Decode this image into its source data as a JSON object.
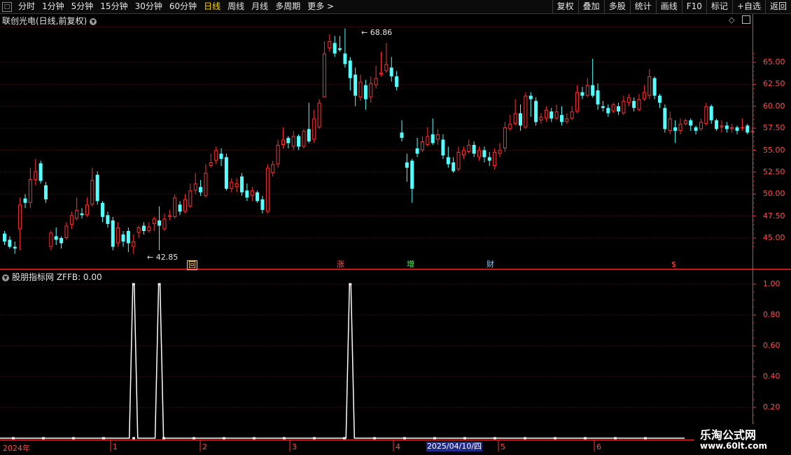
{
  "toolbar": {
    "period_tabs": [
      {
        "label": "分时"
      },
      {
        "label": "1分钟"
      },
      {
        "label": "5分钟"
      },
      {
        "label": "15分钟"
      },
      {
        "label": "30分钟"
      },
      {
        "label": "60分钟"
      },
      {
        "label": "日线",
        "active": true
      },
      {
        "label": "周线"
      },
      {
        "label": "月线"
      },
      {
        "label": "多周期"
      },
      {
        "label": "更多 >"
      }
    ],
    "right_buttons": [
      "复权",
      "叠加",
      "多股",
      "统计",
      "画线",
      "F10",
      "标记",
      "+自选",
      "返回"
    ]
  },
  "main_chart": {
    "title": "联创光电(日线,前复权)",
    "high_label": "68.86",
    "low_label": "42.85",
    "price_axis": [
      "65.00",
      "62.50",
      "60.00",
      "57.50",
      "55.00",
      "52.50",
      "50.00",
      "47.50",
      "45.00"
    ],
    "events": [
      {
        "label": "回",
        "color": "#ffd27a"
      },
      {
        "label": "涨",
        "color": "#ff5555"
      },
      {
        "label": "增",
        "color": "#4dff4d"
      },
      {
        "label": "财",
        "color": "#88ccff"
      },
      {
        "label": "$",
        "color": "#ff5555"
      }
    ]
  },
  "indicator": {
    "title": "股朋指标网 ZFFB: 0.00",
    "axis": [
      "1.00",
      "0.80",
      "0.60",
      "0.40",
      "0.20"
    ]
  },
  "date_axis": {
    "labels": [
      "2024年",
      "1",
      "2",
      "3",
      "4",
      "5",
      "6"
    ],
    "highlight": "2025/04/10/四"
  },
  "watermark": {
    "line1": "乐淘公式网",
    "line2": "www.60lt.com"
  },
  "colors": {
    "up": "#ff3232",
    "down": "#54ffff",
    "axis": "#ff3232",
    "grid": "#5a1a1a"
  },
  "chart_data": {
    "type": "candlestick",
    "price_range": [
      42.85,
      68.86
    ],
    "candles": [
      [
        45.5,
        44.6,
        45.8,
        44.2
      ],
      [
        44.8,
        44.0,
        45.2,
        43.8
      ],
      [
        44.0,
        43.8,
        44.6,
        43.2
      ],
      [
        46.0,
        48.8,
        49.6,
        43.6
      ],
      [
        49.5,
        49.0,
        50.0,
        48.4
      ],
      [
        49.0,
        51.7,
        53.0,
        48.4
      ],
      [
        51.6,
        52.6,
        54.0,
        51.0
      ],
      [
        53.5,
        51.5,
        53.8,
        51.2
      ],
      [
        51.0,
        49.4,
        51.4,
        49.0
      ],
      [
        44.0,
        45.6,
        45.8,
        43.6
      ],
      [
        45.2,
        44.8,
        46.2,
        44.2
      ],
      [
        45.0,
        44.4,
        45.2,
        43.8
      ],
      [
        45.0,
        46.4,
        46.8,
        44.8
      ],
      [
        46.5,
        47.6,
        48.0,
        46.0
      ],
      [
        47.2,
        48.2,
        49.6,
        47.0
      ],
      [
        47.8,
        47.6,
        48.4,
        47.2
      ],
      [
        47.6,
        48.8,
        49.6,
        47.4
      ],
      [
        48.8,
        51.6,
        53.0,
        48.6
      ],
      [
        52.2,
        49.2,
        52.6,
        48.8
      ],
      [
        49.0,
        47.4,
        49.2,
        46.8
      ],
      [
        47.6,
        46.6,
        48.0,
        46.2
      ],
      [
        47.0,
        44.0,
        47.4,
        43.6
      ],
      [
        44.4,
        46.2,
        46.8,
        44.0
      ],
      [
        45.4,
        44.6,
        45.8,
        44.0
      ],
      [
        45.8,
        44.4,
        46.2,
        43.4
      ],
      [
        44.0,
        44.6,
        45.4,
        43.2
      ],
      [
        45.6,
        46.2,
        46.4,
        45.0
      ],
      [
        46.4,
        45.8,
        46.8,
        45.4
      ],
      [
        45.8,
        46.3,
        46.8,
        45.6
      ],
      [
        46.6,
        47.2,
        47.4,
        45.8
      ],
      [
        47.0,
        46.4,
        48.6,
        43.6
      ],
      [
        46.0,
        47.2,
        47.8,
        45.8
      ],
      [
        47.4,
        47.6,
        48.2,
        47.0
      ],
      [
        47.4,
        49.6,
        50.0,
        47.2
      ],
      [
        48.8,
        48.0,
        49.2,
        47.6
      ],
      [
        48.0,
        49.4,
        50.0,
        47.8
      ],
      [
        48.6,
        50.4,
        51.2,
        48.4
      ],
      [
        50.4,
        51.2,
        52.4,
        50.0
      ],
      [
        50.8,
        50.2,
        51.6,
        49.8
      ],
      [
        49.8,
        52.4,
        53.4,
        49.6
      ],
      [
        53.2,
        53.6,
        54.6,
        53.0
      ],
      [
        53.8,
        55.0,
        55.4,
        53.4
      ],
      [
        54.6,
        54.0,
        55.2,
        53.2
      ],
      [
        54.2,
        50.6,
        54.6,
        50.4
      ],
      [
        50.6,
        51.4,
        51.8,
        50.2
      ],
      [
        50.8,
        51.2,
        51.8,
        50.2
      ],
      [
        52.0,
        50.2,
        52.4,
        49.8
      ],
      [
        50.4,
        49.6,
        51.2,
        49.2
      ],
      [
        49.8,
        50.4,
        50.8,
        49.2
      ],
      [
        50.2,
        49.2,
        50.4,
        49.0
      ],
      [
        49.4,
        48.2,
        49.8,
        47.8
      ],
      [
        48.0,
        53.0,
        53.4,
        47.8
      ],
      [
        52.4,
        53.4,
        53.8,
        52.0
      ],
      [
        53.4,
        55.6,
        56.2,
        53.0
      ],
      [
        55.6,
        56.2,
        57.6,
        55.2
      ],
      [
        56.4,
        55.8,
        56.6,
        55.2
      ],
      [
        55.4,
        56.6,
        57.2,
        55.0
      ],
      [
        56.6,
        55.4,
        56.8,
        55.0
      ],
      [
        55.4,
        57.2,
        57.4,
        55.2
      ],
      [
        57.4,
        56.0,
        60.4,
        55.8
      ],
      [
        56.2,
        58.6,
        59.6,
        55.8
      ],
      [
        57.6,
        60.4,
        60.8,
        57.4
      ],
      [
        61.0,
        66.0,
        67.4,
        61.0
      ],
      [
        66.6,
        67.4,
        68.2,
        66.2
      ],
      [
        67.2,
        66.0,
        68.0,
        65.6
      ],
      [
        66.6,
        66.4,
        68.0,
        66.2
      ],
      [
        66.0,
        64.8,
        68.86,
        64.4
      ],
      [
        65.2,
        63.2,
        65.6,
        61.8
      ],
      [
        63.6,
        61.2,
        64.4,
        60.0
      ],
      [
        61.0,
        62.8,
        63.6,
        60.6
      ],
      [
        62.4,
        60.8,
        63.0,
        59.6
      ],
      [
        61.0,
        62.6,
        63.4,
        60.4
      ],
      [
        62.4,
        63.2,
        64.6,
        62.0
      ],
      [
        63.6,
        63.8,
        66.2,
        63.4
      ],
      [
        64.0,
        64.8,
        67.2,
        63.8
      ],
      [
        64.4,
        63.4,
        65.6,
        62.8
      ],
      [
        63.4,
        62.2,
        64.0,
        61.8
      ],
      [
        57.0,
        56.4,
        58.4,
        56.0
      ],
      [
        53.6,
        53.0,
        54.6,
        51.4
      ],
      [
        53.8,
        50.6,
        54.0,
        49.0
      ],
      [
        55.2,
        54.6,
        56.4,
        54.2
      ],
      [
        55.0,
        56.0,
        56.6,
        54.8
      ],
      [
        55.6,
        56.6,
        57.6,
        55.4
      ],
      [
        56.8,
        55.8,
        58.6,
        55.6
      ],
      [
        56.2,
        56.8,
        57.4,
        55.6
      ],
      [
        56.2,
        54.4,
        56.8,
        54.0
      ],
      [
        54.2,
        53.4,
        55.4,
        53.0
      ],
      [
        53.6,
        52.6,
        54.2,
        52.4
      ],
      [
        52.8,
        54.8,
        55.4,
        52.6
      ],
      [
        54.4,
        55.0,
        55.4,
        54.0
      ],
      [
        54.8,
        55.6,
        56.2,
        54.6
      ],
      [
        55.6,
        54.6,
        56.0,
        54.2
      ],
      [
        54.2,
        55.0,
        55.4,
        53.8
      ],
      [
        55.0,
        54.2,
        55.4,
        53.6
      ],
      [
        54.2,
        53.8,
        54.8,
        53.2
      ],
      [
        53.2,
        54.8,
        55.2,
        52.8
      ],
      [
        54.6,
        55.0,
        55.8,
        54.2
      ],
      [
        55.2,
        57.6,
        58.2,
        54.8
      ],
      [
        57.4,
        58.0,
        59.0,
        57.2
      ],
      [
        58.0,
        59.2,
        60.8,
        57.8
      ],
      [
        59.2,
        57.8,
        60.2,
        57.2
      ],
      [
        57.6,
        61.2,
        61.6,
        57.4
      ],
      [
        61.2,
        60.8,
        61.6,
        58.8
      ],
      [
        60.6,
        58.2,
        61.0,
        57.8
      ],
      [
        58.4,
        58.8,
        59.2,
        58.0
      ],
      [
        58.6,
        59.6,
        60.0,
        58.2
      ],
      [
        59.4,
        58.6,
        59.8,
        58.2
      ],
      [
        58.6,
        59.4,
        60.2,
        58.4
      ],
      [
        59.0,
        58.2,
        60.0,
        57.8
      ],
      [
        58.2,
        58.6,
        59.2,
        58.0
      ],
      [
        58.6,
        59.4,
        60.0,
        58.4
      ],
      [
        59.4,
        61.6,
        62.4,
        59.2
      ],
      [
        61.6,
        61.2,
        62.2,
        60.8
      ],
      [
        61.2,
        62.4,
        63.2,
        61.0
      ],
      [
        62.4,
        61.2,
        65.4,
        61.0
      ],
      [
        61.8,
        60.2,
        62.6,
        59.6
      ],
      [
        60.0,
        59.8,
        60.6,
        59.4
      ],
      [
        59.8,
        59.2,
        60.2,
        58.8
      ],
      [
        59.4,
        60.2,
        60.4,
        59.2
      ],
      [
        60.0,
        59.4,
        60.4,
        59.0
      ],
      [
        59.2,
        60.6,
        61.2,
        59.0
      ],
      [
        60.4,
        61.0,
        61.4,
        60.0
      ],
      [
        60.6,
        59.8,
        61.0,
        59.4
      ],
      [
        59.6,
        60.8,
        61.4,
        59.4
      ],
      [
        60.8,
        61.6,
        62.4,
        60.6
      ],
      [
        61.2,
        63.4,
        64.2,
        60.8
      ],
      [
        63.2,
        61.2,
        63.4,
        60.8
      ],
      [
        61.2,
        60.4,
        61.4,
        59.8
      ],
      [
        59.8,
        57.4,
        60.2,
        57.0
      ],
      [
        57.2,
        58.6,
        59.4,
        56.8
      ],
      [
        57.6,
        57.2,
        58.4,
        55.8
      ],
      [
        57.2,
        58.0,
        58.6,
        56.8
      ],
      [
        58.0,
        58.4,
        58.6,
        57.8
      ],
      [
        58.4,
        57.8,
        58.6,
        57.2
      ],
      [
        57.6,
        57.2,
        57.8,
        56.8
      ],
      [
        57.4,
        58.2,
        58.6,
        57.2
      ],
      [
        58.0,
        60.0,
        60.4,
        57.8
      ],
      [
        60.0,
        58.4,
        60.2,
        58.0
      ],
      [
        58.4,
        57.4,
        58.6,
        57.2
      ],
      [
        57.6,
        57.8,
        58.4,
        57.0
      ],
      [
        57.8,
        57.4,
        58.2,
        57.0
      ],
      [
        57.4,
        57.6,
        58.0,
        57.0
      ],
      [
        57.6,
        57.2,
        57.8,
        56.8
      ],
      [
        57.6,
        57.6,
        58.6,
        57.2
      ],
      [
        57.8,
        57.0,
        58.0,
        56.8
      ],
      [
        57.2,
        57.2,
        57.6,
        56.8
      ]
    ],
    "zffb_spikes": [
      {
        "candle_index": 25,
        "value": 1.0
      },
      {
        "candle_index": 30,
        "value": 1.0
      },
      {
        "candle_index": 67,
        "value": 1.0
      }
    ]
  }
}
